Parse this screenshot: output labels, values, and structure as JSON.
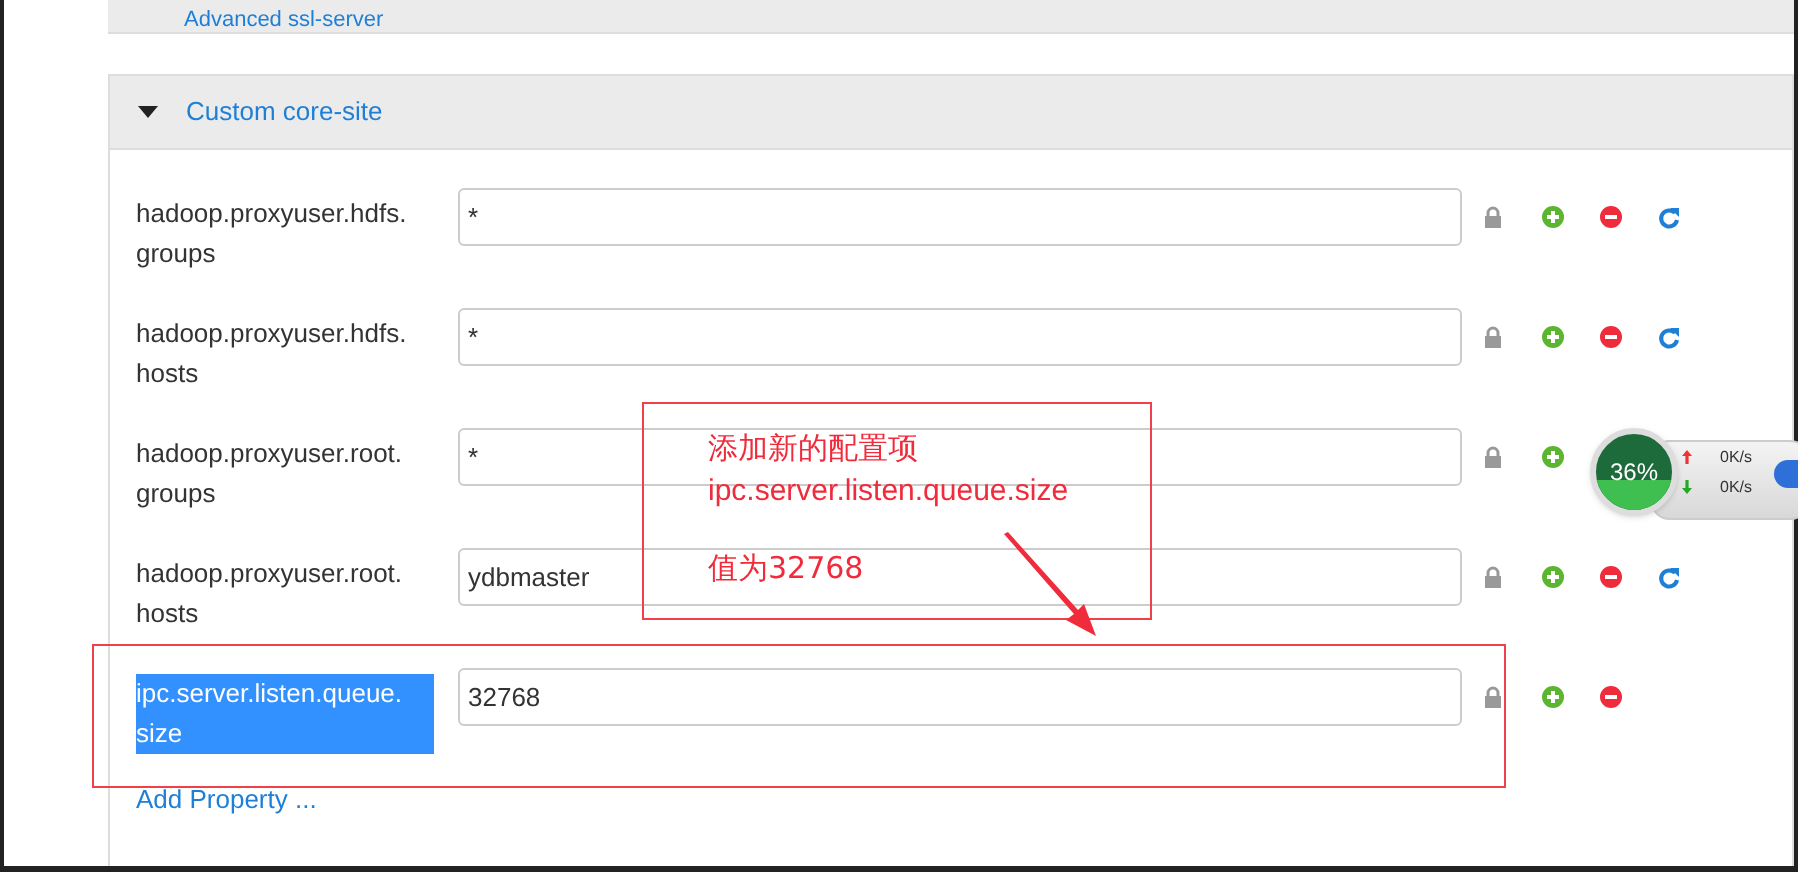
{
  "top_section": {
    "title": "Advanced ssl-server"
  },
  "section": {
    "title": "Custom core-site",
    "expanded": true
  },
  "properties": [
    {
      "name": "hadoop.proxyuser.hdfs.groups",
      "value": "*",
      "selected": false,
      "actions": [
        {
          "kind": "lock"
        },
        {
          "kind": "add"
        },
        {
          "kind": "remove"
        },
        {
          "kind": "revert"
        }
      ]
    },
    {
      "name": "hadoop.proxyuser.hdfs.hosts",
      "value": "*",
      "selected": false,
      "actions": [
        {
          "kind": "lock"
        },
        {
          "kind": "add"
        },
        {
          "kind": "remove"
        },
        {
          "kind": "revert"
        }
      ]
    },
    {
      "name": "hadoop.proxyuser.root.groups",
      "value": "*",
      "selected": false,
      "actions": [
        {
          "kind": "lock"
        },
        {
          "kind": "add"
        }
      ]
    },
    {
      "name": "hadoop.proxyuser.root.hosts",
      "value": "ydbmaster",
      "selected": false,
      "actions": [
        {
          "kind": "lock"
        },
        {
          "kind": "add"
        },
        {
          "kind": "remove"
        },
        {
          "kind": "revert"
        }
      ]
    },
    {
      "name": "ipc.server.listen.queue.size",
      "value": "32768",
      "selected": true,
      "actions": [
        {
          "kind": "lock"
        },
        {
          "kind": "add"
        },
        {
          "kind": "remove"
        }
      ]
    }
  ],
  "add_property": "Add Property ...",
  "annotation": {
    "lines": [
      "添加新的配置项",
      "ipc.server.listen.queue.size",
      "值为32768"
    ]
  },
  "speed_widget": {
    "percent": "36%",
    "upload": "0K/s",
    "download": "0K/s"
  }
}
